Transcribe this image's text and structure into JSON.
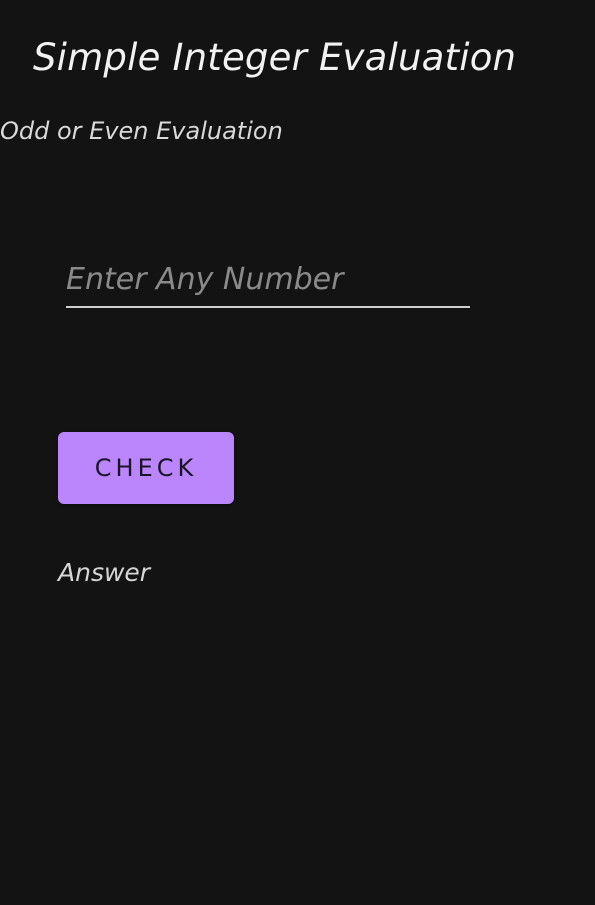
{
  "app": {
    "title": "Simple Integer Evaluation",
    "subtitle": "Odd or Even Evaluation"
  },
  "form": {
    "number_input": {
      "value": "",
      "placeholder": "Enter Any Number"
    },
    "check_label": "CHECK",
    "answer_text": "Answer"
  },
  "colors": {
    "background": "#131313",
    "accent": "#bb86fc"
  }
}
